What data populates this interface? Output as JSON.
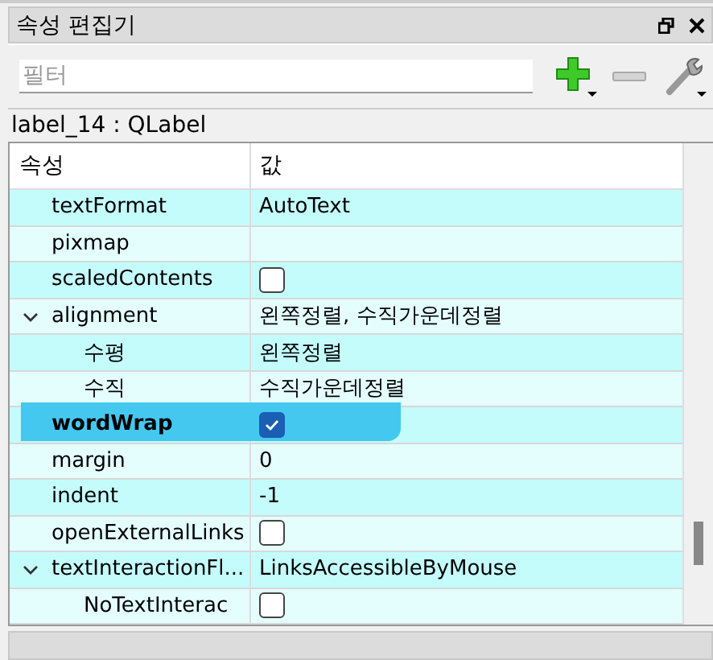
{
  "panel": {
    "title": "속성 편집기"
  },
  "filter": {
    "placeholder": "필터"
  },
  "object_label": "label_14 : QLabel",
  "table": {
    "columns": [
      "속성",
      "값"
    ],
    "rows": [
      {
        "name": "textFormat",
        "kind": "text",
        "value": "AutoText"
      },
      {
        "name": "pixmap",
        "kind": "empty"
      },
      {
        "name": "scaledContents",
        "kind": "checkbox",
        "checked": false
      },
      {
        "name": "alignment",
        "kind": "text",
        "value": "왼쪽정렬, 수직가운데정렬",
        "expanded": true,
        "children": [
          {
            "name": "수평",
            "kind": "text",
            "value": "왼쪽정렬"
          },
          {
            "name": "수직",
            "kind": "text",
            "value": "수직가운데정렬"
          }
        ]
      },
      {
        "name": "wordWrap",
        "kind": "checkbox",
        "checked": true,
        "modified": true,
        "highlighted": true
      },
      {
        "name": "margin",
        "kind": "text",
        "value": "0"
      },
      {
        "name": "indent",
        "kind": "text",
        "value": "-1"
      },
      {
        "name": "openExternalLinks",
        "kind": "checkbox",
        "checked": false
      },
      {
        "name": "textInteractionFl...",
        "kind": "text",
        "value": "LinksAccessibleByMouse",
        "expanded": true,
        "children": [
          {
            "name": "NoTextInterac",
            "kind": "checkbox",
            "checked": false
          }
        ]
      }
    ]
  }
}
